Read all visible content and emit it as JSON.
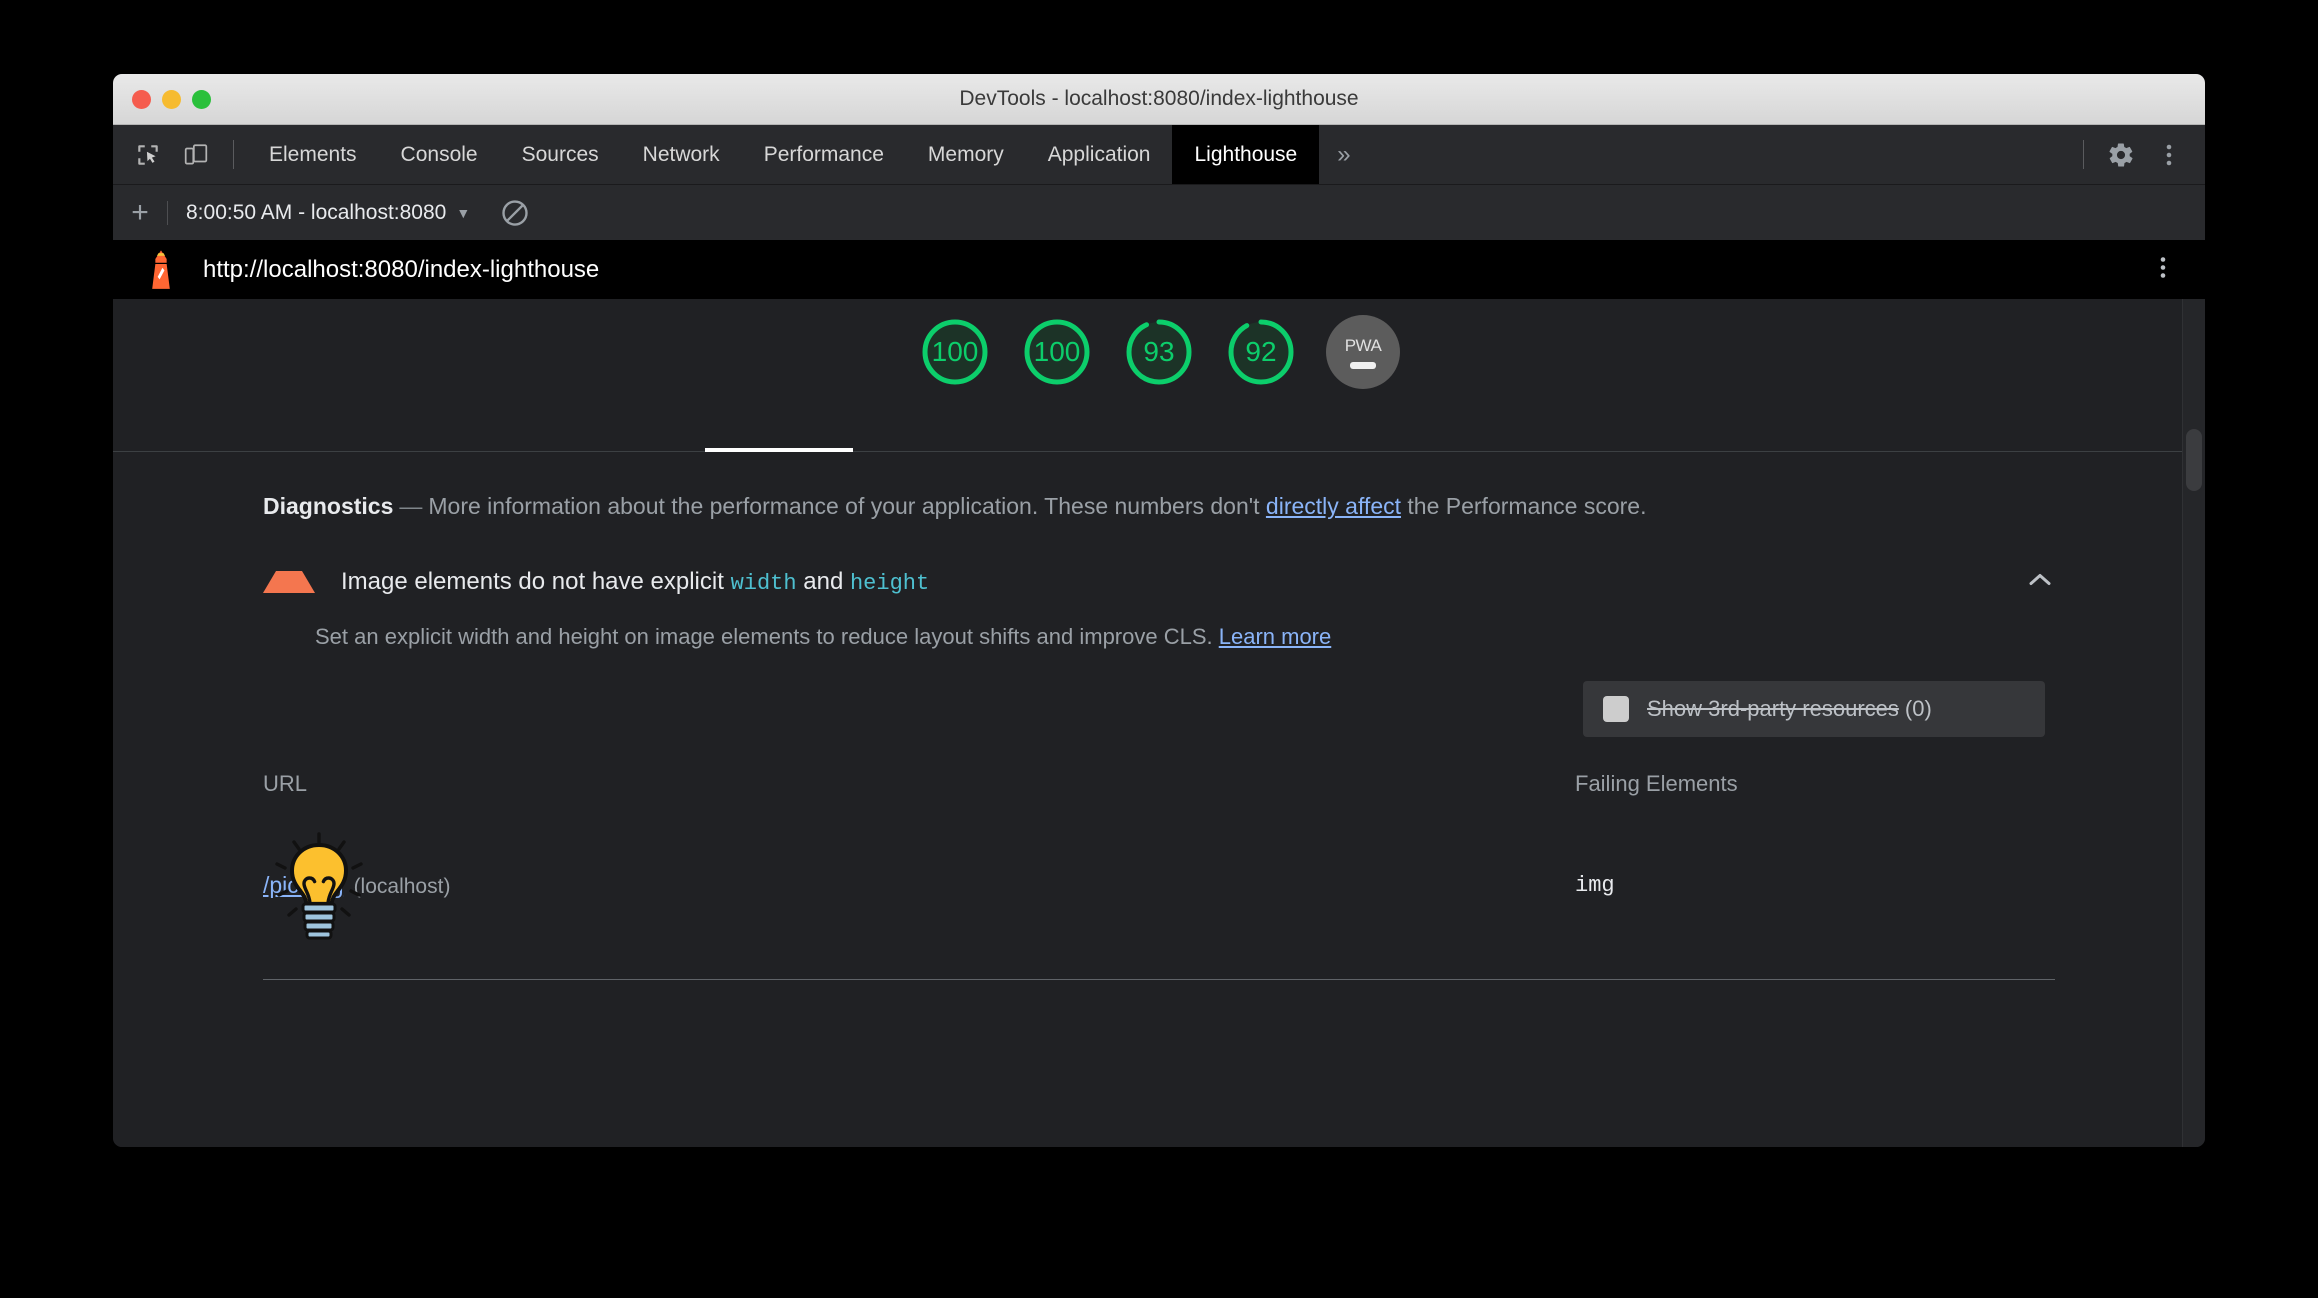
{
  "window": {
    "title": "DevTools - localhost:8080/index-lighthouse"
  },
  "tabbar": {
    "inspect_icon": "inspect-element-icon",
    "device_icon": "device-toolbar-icon",
    "tabs": [
      {
        "label": "Elements",
        "active": false
      },
      {
        "label": "Console",
        "active": false
      },
      {
        "label": "Sources",
        "active": false
      },
      {
        "label": "Network",
        "active": false
      },
      {
        "label": "Performance",
        "active": false
      },
      {
        "label": "Memory",
        "active": false
      },
      {
        "label": "Application",
        "active": false
      },
      {
        "label": "Lighthouse",
        "active": true
      }
    ],
    "more_label": "»",
    "settings_icon": "gear-icon",
    "menu_icon": "kebab-menu-icon"
  },
  "lighthouse_toolbar": {
    "add_label": "+",
    "run_selected": "8:00:50 AM - localhost:8080",
    "caret": "▼",
    "clear_icon": "clear-all-icon"
  },
  "report": {
    "url": "http://localhost:8080/index-lighthouse",
    "logo_icon": "lighthouse-logo-icon",
    "kebab_icon": "report-menu-icon",
    "gauges": [
      {
        "name": "performance",
        "score": "100",
        "value": 100,
        "color": "#0cce6b"
      },
      {
        "name": "accessibility",
        "score": "100",
        "value": 100,
        "color": "#0cce6b"
      },
      {
        "name": "best-practices",
        "score": "93",
        "value": 93,
        "color": "#0cce6b"
      },
      {
        "name": "seo",
        "score": "92",
        "value": 92,
        "color": "#0cce6b"
      }
    ],
    "pwa": {
      "label": "PWA",
      "state": "null"
    },
    "diagnostics": {
      "heading": "Diagnostics",
      "dash": "—",
      "text_before_link": "More information about the performance of your application. These numbers don't ",
      "link_text": "directly affect",
      "text_after_link": " the Performance score."
    },
    "audit": {
      "title_part1": "Image elements do not have explicit ",
      "code1": "width",
      "title_part2": " and ",
      "code2": "height",
      "chevron": "chevron-up",
      "description": "Set an explicit width and height on image elements to reduce layout shifts and improve CLS. ",
      "learn_more": "Learn more",
      "third_party_label": "Show 3rd-party resources",
      "third_party_count": "(0)",
      "columns": [
        "URL",
        "Failing Elements"
      ],
      "rows": [
        {
          "icon": "lightbulb-icon",
          "url": "/pic.png",
          "host": "(localhost)",
          "failing_element": "img"
        }
      ]
    }
  },
  "colors": {
    "score_green": "#0cce6b",
    "link_blue": "#8ab4f8",
    "code_teal": "#4ec0d0",
    "warning_orange": "#f4764f",
    "panel_bg": "#202124",
    "toolbar_bg": "#292a2d"
  }
}
